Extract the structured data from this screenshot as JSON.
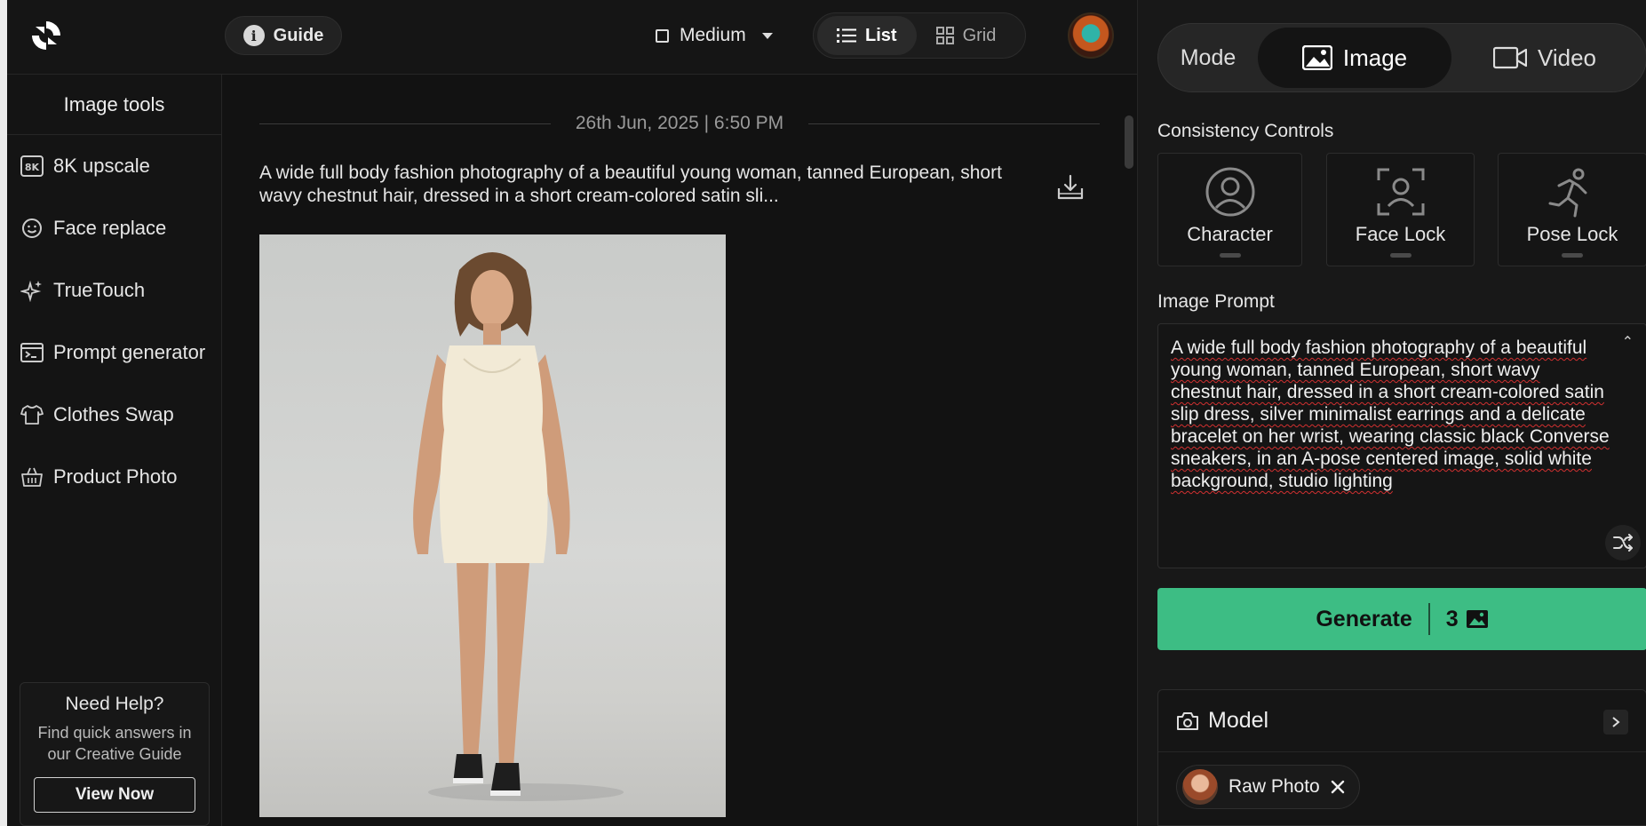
{
  "header": {
    "guide_label": "Guide",
    "size_label": "Medium",
    "view_list_label": "List",
    "view_grid_label": "Grid"
  },
  "sidebar": {
    "title": "Image tools",
    "items": [
      {
        "label": "8K upscale",
        "icon": "8k-icon"
      },
      {
        "label": "Face replace",
        "icon": "smiley-icon"
      },
      {
        "label": "TrueTouch",
        "icon": "sparkle-icon"
      },
      {
        "label": "Prompt generator",
        "icon": "terminal-icon"
      },
      {
        "label": "Clothes Swap",
        "icon": "shirt-icon"
      },
      {
        "label": "Product Photo",
        "icon": "basket-icon"
      }
    ],
    "help": {
      "title": "Need Help?",
      "text": "Find quick answers in our Creative Guide",
      "button": "View Now"
    }
  },
  "feed": {
    "timestamp": "26th Jun, 2025 | 6:50 PM",
    "prompt_preview": "A wide full body fashion photography of a beautiful young woman, tanned European, short wavy chestnut hair, dressed in a short cream-colored satin sli..."
  },
  "panel": {
    "mode_label": "Mode",
    "mode_image": "Image",
    "mode_video": "Video",
    "consistency_title": "Consistency Controls",
    "controls": [
      "Character",
      "Face Lock",
      "Pose Lock"
    ],
    "prompt_title": "Image Prompt",
    "prompt_text": "A wide full body fashion photography of a beautiful young woman, tanned European, short wavy chestnut hair, dressed in a short cream-colored satin slip dress, silver minimalist earrings and a delicate bracelet on her wrist, wearing classic black Converse sneakers, in an A-pose centered image, solid white background, studio lighting",
    "generate_label": "Generate",
    "generate_cost": "3",
    "model_title": "Model",
    "model_chip": "Raw Photo"
  },
  "colors": {
    "accent": "#3dbd84",
    "background": "#121212",
    "panel": "#181818"
  }
}
